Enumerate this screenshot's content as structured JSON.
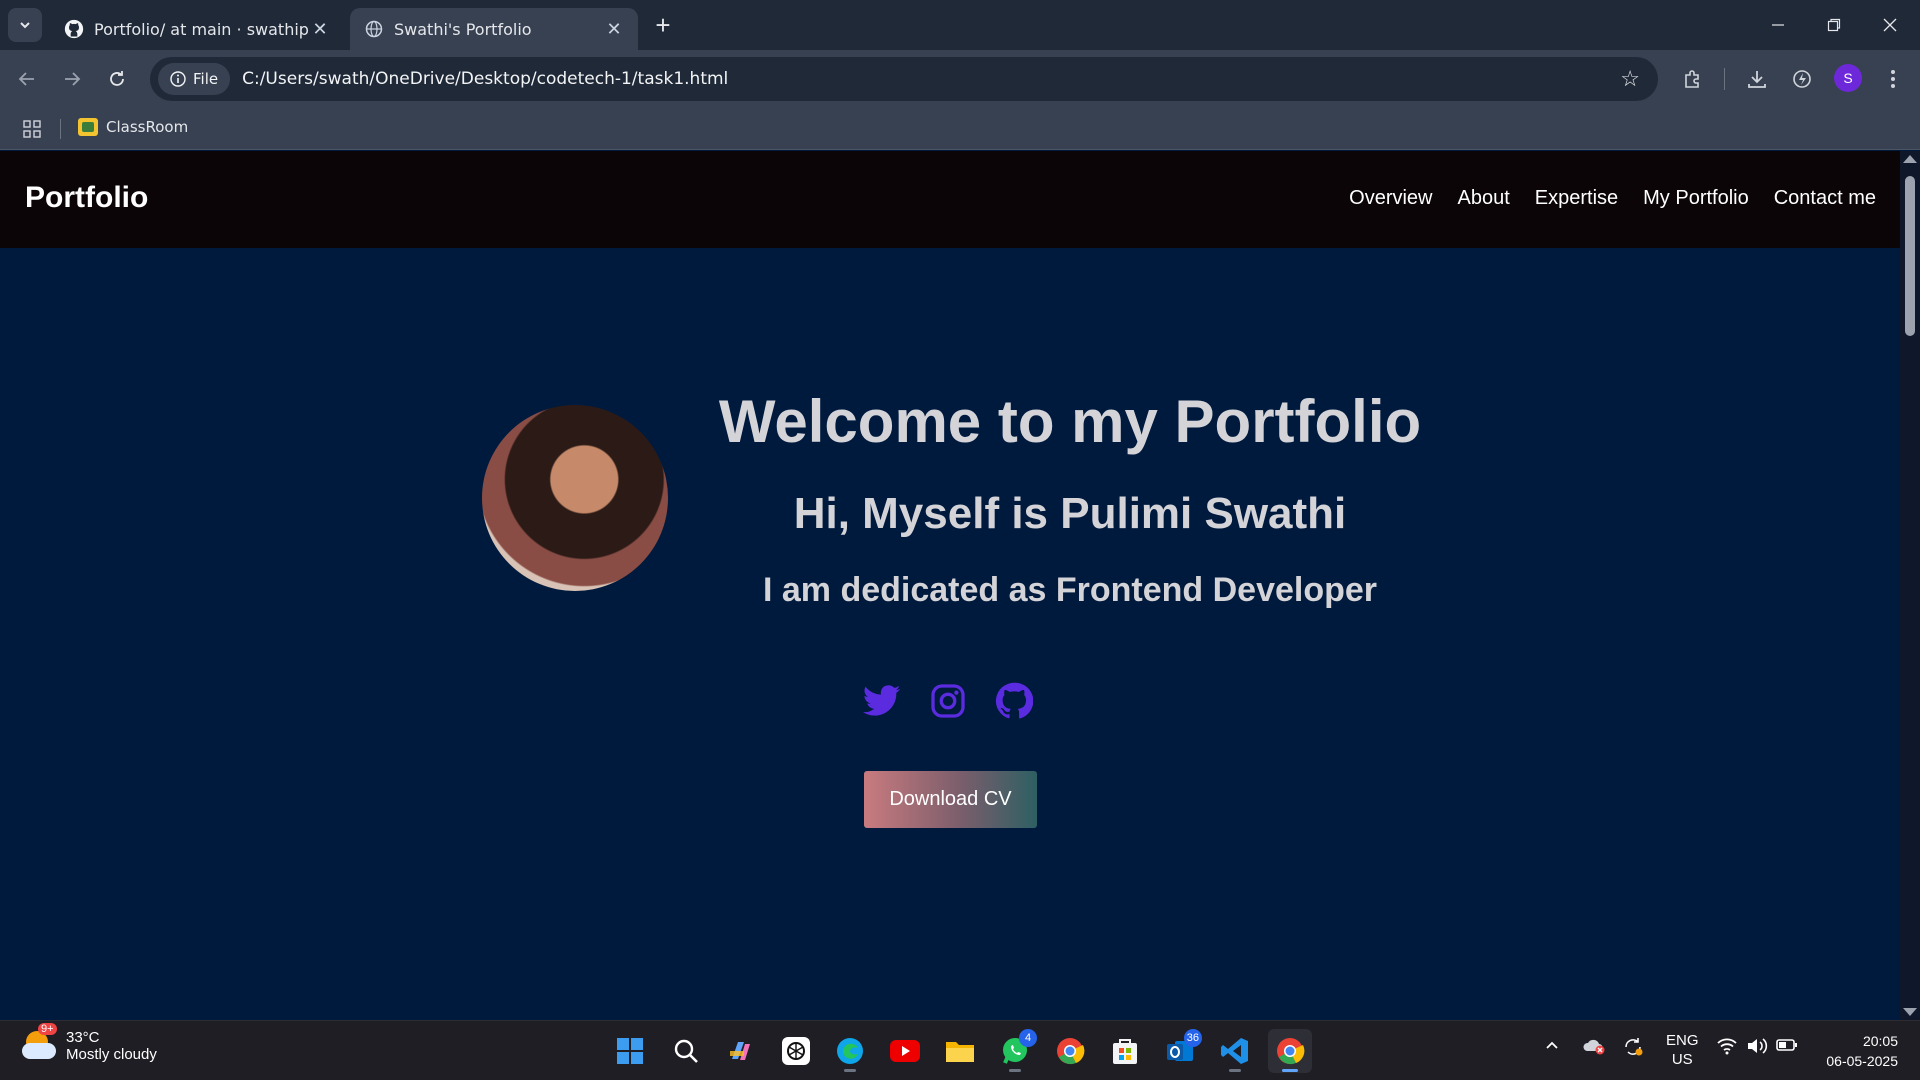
{
  "browser": {
    "tabs": [
      {
        "title": "Portfolio/ at main · swathipulimi",
        "active": false
      },
      {
        "title": "Swathi's Portfolio",
        "active": true
      }
    ],
    "address": {
      "chip_label": "File",
      "url": "C:/Users/swath/OneDrive/Desktop/codetech-1/task1.html"
    },
    "profile_initial": "S",
    "bookmarks": [
      {
        "label": "ClassRoom"
      }
    ]
  },
  "site": {
    "brand": "Portfolio",
    "nav": [
      "Overview",
      "About",
      "Expertise",
      "My Portfolio",
      "Contact me"
    ],
    "hero": {
      "title": "Welcome to my Portfolio",
      "greeting": "Hi, Myself is Pulimi Swathi",
      "role": "I am dedicated as Frontend Developer",
      "socials": [
        "twitter-icon",
        "instagram-icon",
        "github-icon"
      ],
      "cta": "Download CV"
    }
  },
  "colors": {
    "page_bg": "#001a3e",
    "nav_bg": "#0b0508",
    "social": "#5b2be0",
    "hero_text": "#d4d4d8"
  },
  "taskbar": {
    "weather": {
      "temp": "33°C",
      "condition": "Mostly cloudy",
      "badge": "9+"
    },
    "badges": {
      "whatsapp": "4",
      "outlook": "36"
    },
    "language": {
      "lang": "ENG",
      "region": "US"
    },
    "clock": {
      "time": "20:05",
      "date": "06-05-2025"
    }
  }
}
